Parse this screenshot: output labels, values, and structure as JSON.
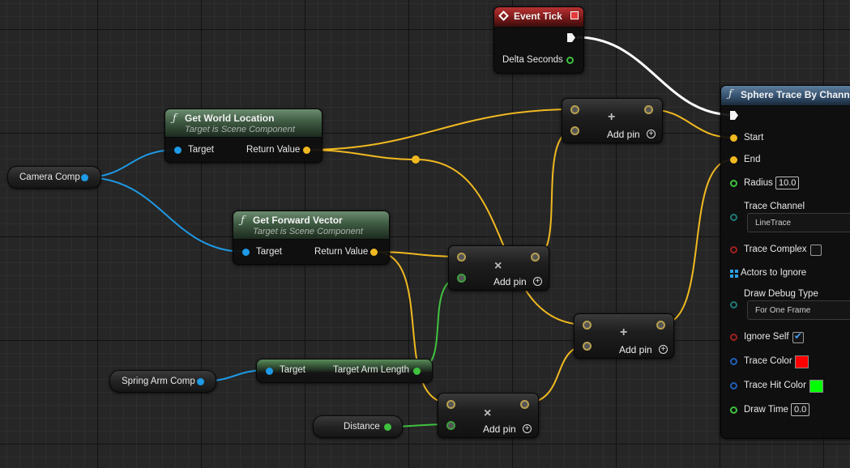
{
  "event_tick": {
    "title": "Event Tick",
    "delta_seconds_label": "Delta Seconds"
  },
  "get_world_location": {
    "title": "Get World Location",
    "subtitle": "Target is Scene Component",
    "target_label": "Target",
    "return_label": "Return Value"
  },
  "get_forward_vector": {
    "title": "Get Forward Vector",
    "subtitle": "Target is Scene Component",
    "target_label": "Target",
    "return_label": "Return Value"
  },
  "camera_comp": {
    "label": "Camera Comp"
  },
  "spring_arm_comp": {
    "label": "Spring Arm Comp"
  },
  "distance": {
    "label": "Distance"
  },
  "target_arm_length": {
    "target_label": "Target",
    "output_label": "Target Arm Length"
  },
  "math_nodes": {
    "add_top": {
      "symbol": "+",
      "add_pin_label": "Add pin"
    },
    "mul_mid": {
      "symbol": "×",
      "add_pin_label": "Add pin"
    },
    "add_right": {
      "symbol": "+",
      "add_pin_label": "Add pin"
    },
    "mul_bottom": {
      "symbol": "×",
      "add_pin_label": "Add pin"
    }
  },
  "sphere_trace": {
    "title": "Sphere Trace By Channel",
    "start_label": "Start",
    "end_label": "End",
    "radius_label": "Radius",
    "radius_value": "10.0",
    "trace_channel_label": "Trace Channel",
    "trace_channel_value": "LineTrace",
    "trace_complex_label": "Trace Complex",
    "trace_complex_checked": false,
    "actors_to_ignore_label": "Actors to Ignore",
    "draw_debug_type_label": "Draw Debug Type",
    "draw_debug_type_value": "For One Frame",
    "ignore_self_label": "Ignore Self",
    "ignore_self_checked": true,
    "trace_color_label": "Trace Color",
    "trace_color": "#ff0000",
    "trace_hit_color_label": "Trace Hit Color",
    "trace_hit_color": "#00ff00",
    "draw_time_label": "Draw Time",
    "draw_time_value": "0.0"
  },
  "colors": {
    "exec_wire": "#ffffff",
    "object_wire": "#1e9ae6",
    "vector_wire": "#f0b921",
    "float_wire": "#3fc23f",
    "canvas_background": "#262626"
  }
}
